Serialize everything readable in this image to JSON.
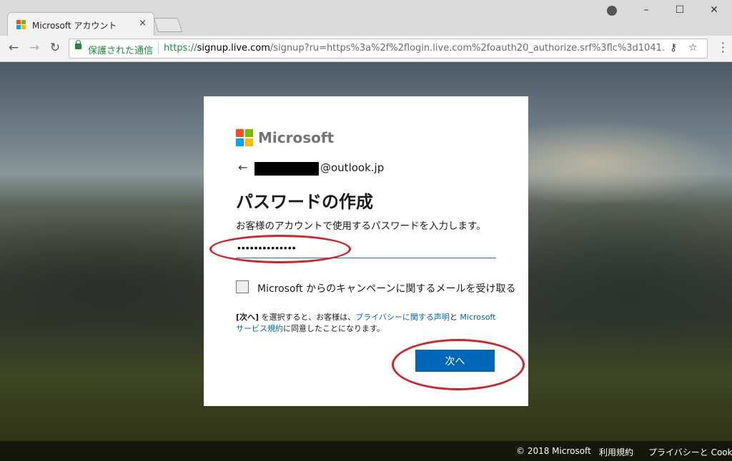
{
  "browser": {
    "tab_title": "Microsoft アカウント",
    "tab_close": "×",
    "url_security": "保護された通信",
    "url_protocol": "https://",
    "url_host": "signup.live.com",
    "url_rest": "/signup?ru=https%3a%2f%2flogin.live.com%2foauth20_authorize.srf%3flc%3d1041...",
    "window_controls": {
      "minimize": "–",
      "maximize": "☐",
      "close": "✕"
    },
    "nav": {
      "back": "←",
      "forward": "→",
      "reload": "↻"
    },
    "key_icon": "⚷",
    "star_icon": "☆"
  },
  "card": {
    "brand": "Microsoft",
    "back_arrow": "←",
    "email_domain": "@outlook.jp",
    "heading": "パスワードの作成",
    "description": "お客様のアカウントで使用するパスワードを入力します。",
    "password_value": "••••••••••••••",
    "checkbox_label": "Microsoft からのキャンペーンに関するメールを受け取る",
    "terms": {
      "part1": "[次へ]",
      "part2": " を選択すると、お客様は、",
      "privacy_link": "プライバシーに関する声明",
      "part3": "と ",
      "service_link": "Microsoft サービス規約",
      "part4": "に同意したことになります。"
    },
    "next_label": "次へ"
  },
  "footer": {
    "copyright": "© 2018 Microsoft",
    "terms_link": "利用規約",
    "privacy_link": "プライバシーと Cookie"
  },
  "colors": {
    "ms_red": "#f25022",
    "ms_green": "#7fba00",
    "ms_blue": "#00a4ef",
    "ms_yellow": "#ffb900",
    "accent_blue": "#0067b8",
    "annotation_red": "#d2232a"
  }
}
